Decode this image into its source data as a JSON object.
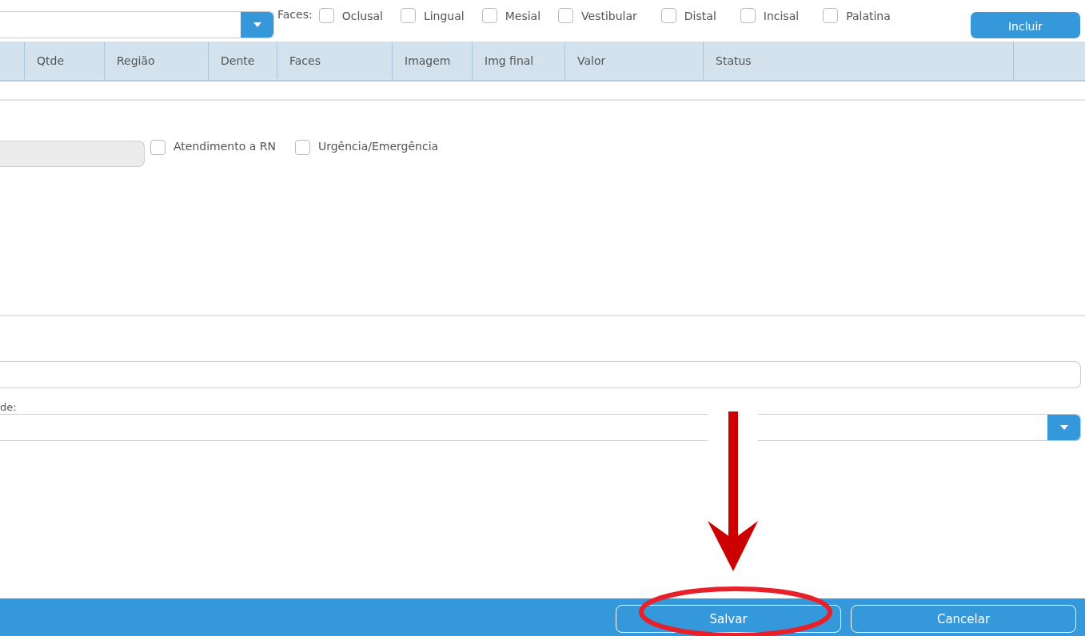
{
  "faces": {
    "label": "Faces:",
    "options": [
      {
        "label": "Oclusal",
        "checked": false
      },
      {
        "label": "Lingual",
        "checked": false
      },
      {
        "label": "Mesial",
        "checked": false
      },
      {
        "label": "Vestibular",
        "checked": false
      },
      {
        "label": "Distal",
        "checked": false
      },
      {
        "label": "Incisal",
        "checked": false
      },
      {
        "label": "Palatina",
        "checked": false
      }
    ]
  },
  "include_button": "Incluir",
  "table": {
    "columns": [
      "",
      "Qtde",
      "Região",
      "Dente",
      "Faces",
      "Imagem",
      "Img final",
      "Valor",
      "Status",
      ""
    ]
  },
  "flags": [
    {
      "label": "Atendimento a RN",
      "checked": false
    },
    {
      "label": "Urgência/Emergência",
      "checked": false
    }
  ],
  "select_label": "de:",
  "footer": {
    "buttons": [
      "Salvar",
      "Cancelar"
    ]
  },
  "annotations": {
    "arrow": true,
    "highlight_ellipse": true
  }
}
